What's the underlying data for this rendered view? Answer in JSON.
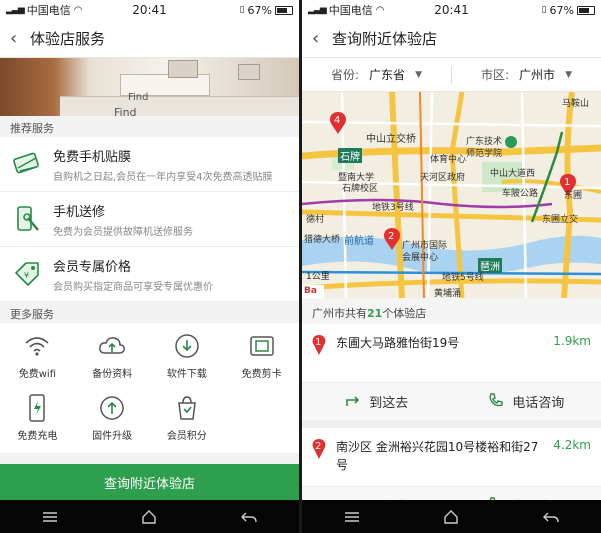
{
  "status": {
    "carrier": "中国电信",
    "time": "20:41",
    "battery": "67%"
  },
  "left": {
    "title": "体验店服务",
    "hero_text": [
      "Find",
      "Find"
    ],
    "recommended_title": "推荐服务",
    "recommended": [
      {
        "name": "免费手机贴膜",
        "desc": "自购机之日起,会员在一年内享受4次免费高透贴膜"
      },
      {
        "name": "手机送修",
        "desc": "免费为会员提供故障机送修服务"
      },
      {
        "name": "会员专属价格",
        "desc": "会员购买指定商品可享受专属优惠价"
      }
    ],
    "more_title": "更多服务",
    "more": [
      {
        "label": "免费wifi"
      },
      {
        "label": "备份资料"
      },
      {
        "label": "软件下载"
      },
      {
        "label": "免费剪卡"
      },
      {
        "label": "免费充电"
      },
      {
        "label": "固件升级"
      },
      {
        "label": "会员积分"
      }
    ],
    "cta": "查询附近体验店"
  },
  "right": {
    "title": "查询附近体验店",
    "province_label": "省份:",
    "province": "广东省",
    "city_label": "市区:",
    "city": "广州市",
    "map_labels": {
      "l1": "中山立交桥",
      "l2": "广东技术",
      "l3": "师范学院",
      "l4": "石牌",
      "l5": "暨南大学",
      "l6": "石牌校区",
      "l7": "天河区政府",
      "l8": "中山大道西",
      "l9": "车陂公路",
      "l10": "东圃立交",
      "l11": "马鞍山",
      "l12": "德村",
      "l13": "前航道",
      "l14": "猎德大桥",
      "l15": "广州市国际",
      "l16": "会展中心",
      "l17": "琶洲",
      "l18": "黄埔涌",
      "scale": "1公里",
      "l19": "地铁3号线",
      "l20": "地铁5号线",
      "l21": "体育中心",
      "l22": "东圃"
    },
    "map_pins": [
      "4",
      "2",
      "1"
    ],
    "count_prefix": "广州市共有",
    "count": "21",
    "count_suffix": "个体验店",
    "stores": [
      {
        "num": "1",
        "addr": "东圃大马路雅怡街19号",
        "dist": "1.9km"
      },
      {
        "num": "2",
        "addr": "南沙区 金洲裕兴花园10号楼裕和街27号",
        "dist": "4.2km"
      }
    ],
    "go_label": "到这去",
    "call_label": "电话咨询",
    "colors": {
      "accent": "#2e9e4f",
      "pin": "#e23030"
    }
  }
}
